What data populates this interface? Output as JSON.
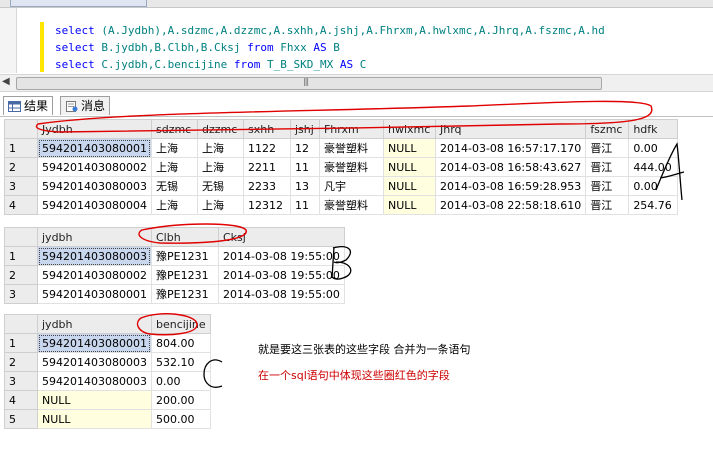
{
  "sql": {
    "line1": "select (A.Jydbh),A.sdzmc,A.dzzmc,A.sxhh,A.jshj,A.Fhrxm,A.hwlxmc,A.Jhrq,A.fszmc,A.hd",
    "line2": "select B.jydbh,B.Clbh,B.Cksj from Fhxx AS B",
    "line3": "select C.jydbh,C.bencijine from T_B_SKD_MX AS C"
  },
  "tabs": {
    "results": "结果",
    "messages": "消息"
  },
  "gridA": {
    "columns": [
      "Jydbh",
      "sdzmc",
      "dzzmc",
      "sxhh",
      "jshj",
      "Fhrxm",
      "hwlxmc",
      "Jhrq",
      "fszmc",
      "hdfk"
    ],
    "rows": [
      [
        "1",
        "594201403080001",
        "上海",
        "上海",
        "1122",
        "12",
        "豪誉塑料",
        "NULL",
        "2014-03-08 16:57:17.170",
        "晋江",
        "0.00"
      ],
      [
        "2",
        "594201403080002",
        "上海",
        "上海",
        "2211",
        "11",
        "豪誉塑料",
        "NULL",
        "2014-03-08 16:58:43.627",
        "晋江",
        "444.00"
      ],
      [
        "3",
        "594201403080003",
        "无锡",
        "无锡",
        "2233",
        "13",
        "凡宇",
        "NULL",
        "2014-03-08 16:59:28.953",
        "晋江",
        "0.00"
      ],
      [
        "4",
        "594201403080004",
        "上海",
        "上海",
        "12312",
        "11",
        "豪誉塑料",
        "NULL",
        "2014-03-08 22:58:18.610",
        "晋江",
        "254.76"
      ]
    ]
  },
  "gridB": {
    "columns": [
      "jydbh",
      "Clbh",
      "Cksj"
    ],
    "rows": [
      [
        "1",
        "594201403080003",
        "豫PE1231",
        "2014-03-08 19:55:00"
      ],
      [
        "2",
        "594201403080002",
        "豫PE1231",
        "2014-03-08 19:55:00"
      ],
      [
        "3",
        "594201403080001",
        "豫PE1231",
        "2014-03-08 19:55:00"
      ]
    ]
  },
  "gridC": {
    "columns": [
      "jydbh",
      "bencijine"
    ],
    "rows": [
      [
        "1",
        "594201403080001",
        "804.00"
      ],
      [
        "2",
        "594201403080003",
        "532.10"
      ],
      [
        "3",
        "594201403080003",
        "0.00"
      ],
      [
        "4",
        "NULL",
        "200.00"
      ],
      [
        "5",
        "NULL",
        "500.00"
      ]
    ]
  },
  "annotations": {
    "note1": "就是要这三张表的这些字段 合并为一条语句",
    "note2": "在一个sql语句中体现这些圈红色的字段",
    "colors": {
      "circle": "#e00000",
      "note2": "#cc0000",
      "selection": "#c9d7ee",
      "null_bg": "#ffffe0"
    },
    "letters": [
      "A",
      "B",
      "C"
    ]
  }
}
